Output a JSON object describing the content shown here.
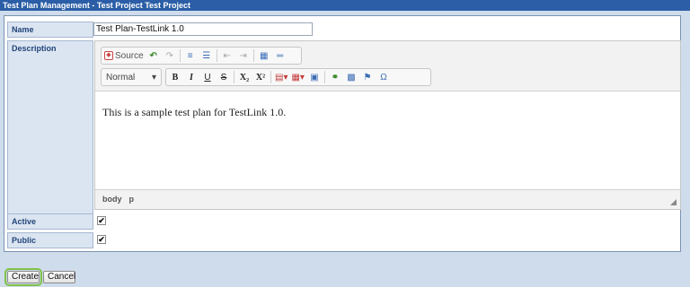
{
  "window": {
    "title": "Test Plan Management - Test Project Test Project"
  },
  "form": {
    "name_label": "Name",
    "name_value": "Test Plan-TestLink 1.0",
    "description_label": "Description",
    "active_label": "Active",
    "active_checked": true,
    "public_label": "Public",
    "public_checked": true
  },
  "editor": {
    "source_label": "Source",
    "format_value": "Normal",
    "content": "This is a sample test plan for TestLink 1.0.",
    "path": [
      "body",
      "p"
    ],
    "toolbar_icons": [
      "source-icon",
      "undo-icon",
      "redo-icon",
      "numbered-list-icon",
      "bulleted-list-icon",
      "outdent-icon",
      "indent-icon",
      "table-icon",
      "horizontal-rule-icon",
      "bold-icon",
      "italic-icon",
      "underline-icon",
      "strikethrough-icon",
      "subscript-icon",
      "superscript-icon",
      "text-color-icon",
      "table-insert-icon",
      "image-icon",
      "link-icon",
      "embed-icon",
      "flag-icon",
      "special-char-icon"
    ]
  },
  "buttons": {
    "create": "Create",
    "cancel": "Cancel"
  },
  "colors": {
    "titlebar": "#2b5ea6",
    "label_bg": "#dbe5f1",
    "label_text": "#22457a",
    "page_bg": "#cfdcec",
    "create_focus": "#7fc14a"
  }
}
